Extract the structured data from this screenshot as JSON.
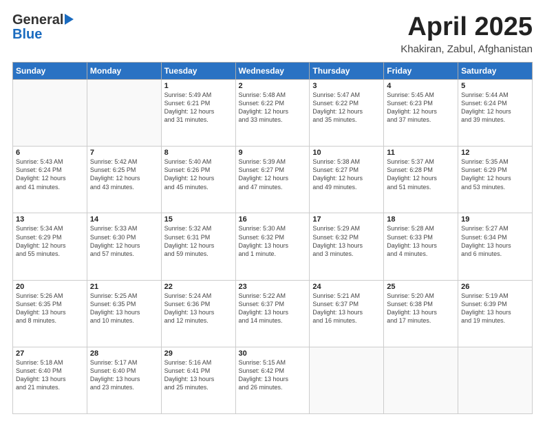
{
  "header": {
    "logo_general": "General",
    "logo_blue": "Blue",
    "title": "April 2025",
    "subtitle": "Khakiran, Zabul, Afghanistan"
  },
  "columns": [
    "Sunday",
    "Monday",
    "Tuesday",
    "Wednesday",
    "Thursday",
    "Friday",
    "Saturday"
  ],
  "weeks": [
    [
      {
        "day": "",
        "info": ""
      },
      {
        "day": "",
        "info": ""
      },
      {
        "day": "1",
        "info": "Sunrise: 5:49 AM\nSunset: 6:21 PM\nDaylight: 12 hours\nand 31 minutes."
      },
      {
        "day": "2",
        "info": "Sunrise: 5:48 AM\nSunset: 6:22 PM\nDaylight: 12 hours\nand 33 minutes."
      },
      {
        "day": "3",
        "info": "Sunrise: 5:47 AM\nSunset: 6:22 PM\nDaylight: 12 hours\nand 35 minutes."
      },
      {
        "day": "4",
        "info": "Sunrise: 5:45 AM\nSunset: 6:23 PM\nDaylight: 12 hours\nand 37 minutes."
      },
      {
        "day": "5",
        "info": "Sunrise: 5:44 AM\nSunset: 6:24 PM\nDaylight: 12 hours\nand 39 minutes."
      }
    ],
    [
      {
        "day": "6",
        "info": "Sunrise: 5:43 AM\nSunset: 6:24 PM\nDaylight: 12 hours\nand 41 minutes."
      },
      {
        "day": "7",
        "info": "Sunrise: 5:42 AM\nSunset: 6:25 PM\nDaylight: 12 hours\nand 43 minutes."
      },
      {
        "day": "8",
        "info": "Sunrise: 5:40 AM\nSunset: 6:26 PM\nDaylight: 12 hours\nand 45 minutes."
      },
      {
        "day": "9",
        "info": "Sunrise: 5:39 AM\nSunset: 6:27 PM\nDaylight: 12 hours\nand 47 minutes."
      },
      {
        "day": "10",
        "info": "Sunrise: 5:38 AM\nSunset: 6:27 PM\nDaylight: 12 hours\nand 49 minutes."
      },
      {
        "day": "11",
        "info": "Sunrise: 5:37 AM\nSunset: 6:28 PM\nDaylight: 12 hours\nand 51 minutes."
      },
      {
        "day": "12",
        "info": "Sunrise: 5:35 AM\nSunset: 6:29 PM\nDaylight: 12 hours\nand 53 minutes."
      }
    ],
    [
      {
        "day": "13",
        "info": "Sunrise: 5:34 AM\nSunset: 6:29 PM\nDaylight: 12 hours\nand 55 minutes."
      },
      {
        "day": "14",
        "info": "Sunrise: 5:33 AM\nSunset: 6:30 PM\nDaylight: 12 hours\nand 57 minutes."
      },
      {
        "day": "15",
        "info": "Sunrise: 5:32 AM\nSunset: 6:31 PM\nDaylight: 12 hours\nand 59 minutes."
      },
      {
        "day": "16",
        "info": "Sunrise: 5:30 AM\nSunset: 6:32 PM\nDaylight: 13 hours\nand 1 minute."
      },
      {
        "day": "17",
        "info": "Sunrise: 5:29 AM\nSunset: 6:32 PM\nDaylight: 13 hours\nand 3 minutes."
      },
      {
        "day": "18",
        "info": "Sunrise: 5:28 AM\nSunset: 6:33 PM\nDaylight: 13 hours\nand 4 minutes."
      },
      {
        "day": "19",
        "info": "Sunrise: 5:27 AM\nSunset: 6:34 PM\nDaylight: 13 hours\nand 6 minutes."
      }
    ],
    [
      {
        "day": "20",
        "info": "Sunrise: 5:26 AM\nSunset: 6:35 PM\nDaylight: 13 hours\nand 8 minutes."
      },
      {
        "day": "21",
        "info": "Sunrise: 5:25 AM\nSunset: 6:35 PM\nDaylight: 13 hours\nand 10 minutes."
      },
      {
        "day": "22",
        "info": "Sunrise: 5:24 AM\nSunset: 6:36 PM\nDaylight: 13 hours\nand 12 minutes."
      },
      {
        "day": "23",
        "info": "Sunrise: 5:22 AM\nSunset: 6:37 PM\nDaylight: 13 hours\nand 14 minutes."
      },
      {
        "day": "24",
        "info": "Sunrise: 5:21 AM\nSunset: 6:37 PM\nDaylight: 13 hours\nand 16 minutes."
      },
      {
        "day": "25",
        "info": "Sunrise: 5:20 AM\nSunset: 6:38 PM\nDaylight: 13 hours\nand 17 minutes."
      },
      {
        "day": "26",
        "info": "Sunrise: 5:19 AM\nSunset: 6:39 PM\nDaylight: 13 hours\nand 19 minutes."
      }
    ],
    [
      {
        "day": "27",
        "info": "Sunrise: 5:18 AM\nSunset: 6:40 PM\nDaylight: 13 hours\nand 21 minutes."
      },
      {
        "day": "28",
        "info": "Sunrise: 5:17 AM\nSunset: 6:40 PM\nDaylight: 13 hours\nand 23 minutes."
      },
      {
        "day": "29",
        "info": "Sunrise: 5:16 AM\nSunset: 6:41 PM\nDaylight: 13 hours\nand 25 minutes."
      },
      {
        "day": "30",
        "info": "Sunrise: 5:15 AM\nSunset: 6:42 PM\nDaylight: 13 hours\nand 26 minutes."
      },
      {
        "day": "",
        "info": ""
      },
      {
        "day": "",
        "info": ""
      },
      {
        "day": "",
        "info": ""
      }
    ]
  ]
}
